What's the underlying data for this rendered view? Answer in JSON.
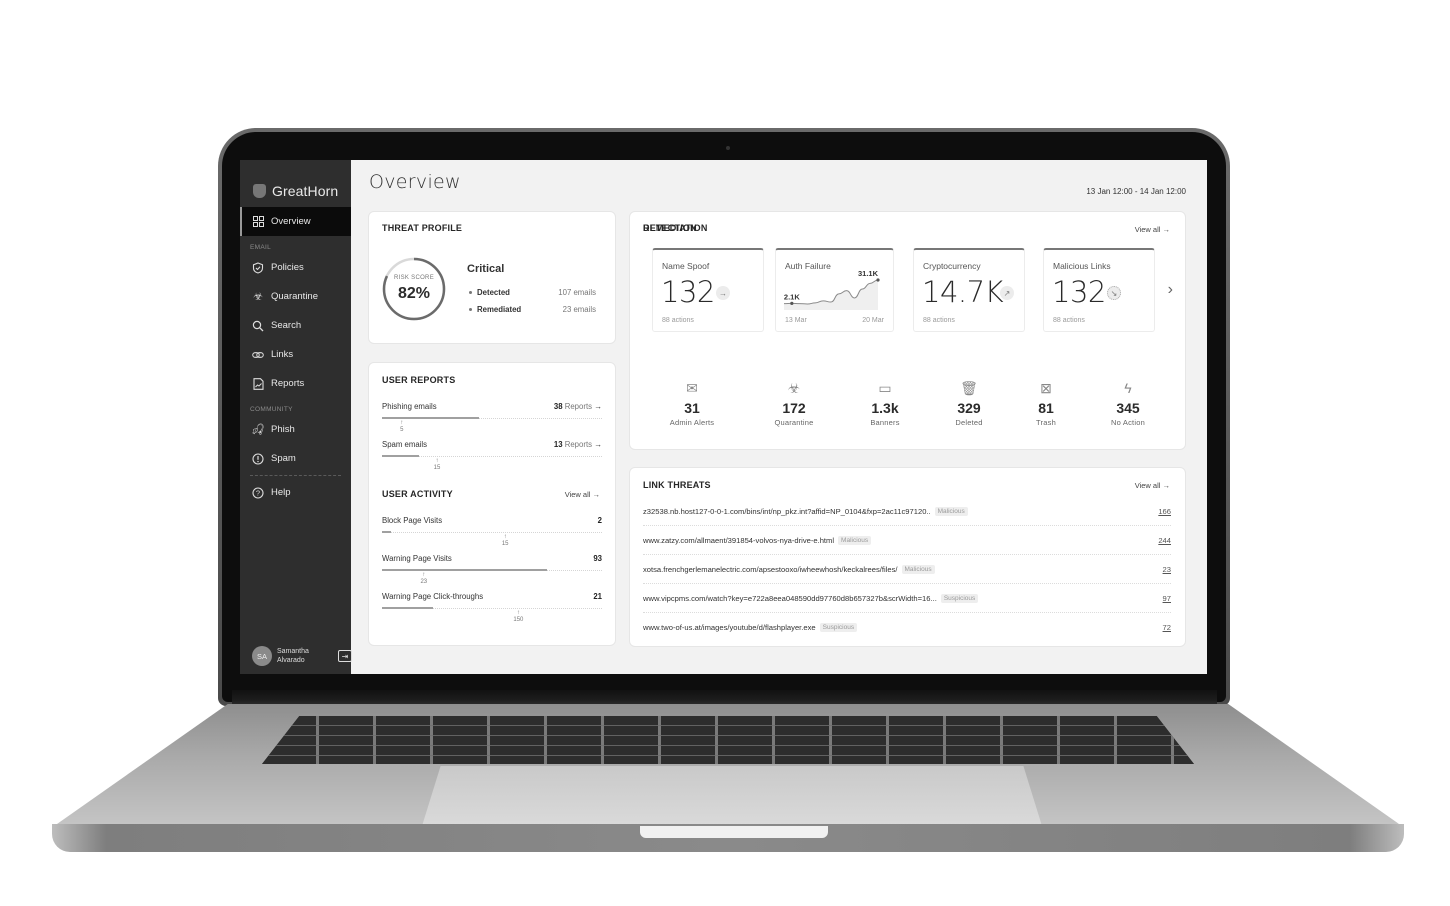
{
  "app": {
    "brand": "GreatHorn",
    "page_title": "Overview",
    "date_range": "13 Jan 12:00 - 14 Jan 12:00"
  },
  "sidebar": {
    "active": "Overview",
    "items": [
      {
        "label": "Overview",
        "icon": "grid-icon"
      },
      {
        "section": "EMAIL"
      },
      {
        "label": "Policies",
        "icon": "shield-check-icon"
      },
      {
        "label": "Quarantine",
        "icon": "biohazard-icon"
      },
      {
        "label": "Search",
        "icon": "search-icon"
      },
      {
        "label": "Links",
        "icon": "link-icon"
      },
      {
        "label": "Reports",
        "icon": "report-icon"
      },
      {
        "section": "COMMUNITY"
      },
      {
        "label": "Phish",
        "icon": "hook-icon"
      },
      {
        "label": "Spam",
        "icon": "alert-circle-icon"
      },
      {
        "label": "Help",
        "icon": "help-circle-icon"
      }
    ],
    "sections": {
      "email": "EMAIL",
      "community": "COMMUNITY"
    },
    "labels": {
      "overview": "Overview",
      "policies": "Policies",
      "quarantine": "Quarantine",
      "search": "Search",
      "links": "Links",
      "reports": "Reports",
      "phish": "Phish",
      "spam": "Spam",
      "help": "Help"
    },
    "user": {
      "initials": "SA",
      "name": "Samantha Alvarado"
    }
  },
  "threat_profile": {
    "title": "THREAT PROFILE",
    "risk_label": "RISK SCORE",
    "risk_score": "82%",
    "risk_fraction": 0.82,
    "status": "Critical",
    "rows": [
      {
        "label": "Detected",
        "value": "107 emails"
      },
      {
        "label": "Remediated",
        "value": "23 emails"
      }
    ]
  },
  "user_reports": {
    "title": "USER REPORTS",
    "items": [
      {
        "label": "Phishing emails",
        "count": "38",
        "unit": "Reports",
        "fill": 0.44,
        "marker": "5",
        "marker_pos": 0.09
      },
      {
        "label": "Spam emails",
        "count": "13",
        "unit": "Reports",
        "fill": 0.17,
        "marker": "15",
        "marker_pos": 0.25
      }
    ]
  },
  "user_activity": {
    "title": "USER ACTIVITY",
    "view_all": "View all",
    "items": [
      {
        "label": "Block Page Visits",
        "value": "2",
        "fill": 0.04,
        "marker": "15",
        "marker_pos": 0.56
      },
      {
        "label": "Warning Page Visits",
        "value": "93",
        "fill": 0.75,
        "marker": "23",
        "marker_pos": 0.19
      },
      {
        "label": "Warning Page Click-throughs",
        "value": "21",
        "fill": 0.23,
        "marker": "150",
        "marker_pos": 0.62
      }
    ]
  },
  "detection": {
    "title": "DETECTION",
    "view_all": "View all",
    "tiles": [
      {
        "title": "Name Spoof",
        "value": "132",
        "trend": "right",
        "sub": "88 actions"
      },
      {
        "title": "Auth Failure",
        "start_label": "2.1K",
        "end_label": "31.1K",
        "x_start": "13 Mar",
        "x_end": "20 Mar",
        "series": [
          2.1,
          2.4,
          2.1,
          1.6,
          3.0,
          5.5,
          4.0,
          14.0,
          18.0,
          9.0,
          20.0,
          27.0,
          31.1
        ]
      },
      {
        "title": "Cryptocurrency",
        "value": "14.7K",
        "trend": "up-right",
        "sub": "88 actions"
      },
      {
        "title": "Malicious Links",
        "value": "132",
        "trend": "down-right",
        "sub": "88 actions"
      }
    ]
  },
  "remediation": {
    "title": "REMEDIATION",
    "items": [
      {
        "value": "31",
        "label": "Admin Alerts",
        "icon": "mail-alert-icon"
      },
      {
        "value": "172",
        "label": "Quarantine",
        "icon": "biohazard-icon"
      },
      {
        "value": "1.3k",
        "label": "Banners",
        "icon": "banner-icon"
      },
      {
        "value": "329",
        "label": "Deleted",
        "icon": "trash-icon"
      },
      {
        "value": "81",
        "label": "Trash",
        "icon": "archive-x-icon"
      },
      {
        "value": "345",
        "label": "No Action",
        "icon": "bolt-icon"
      }
    ]
  },
  "link_threats": {
    "title": "LINK THREATS",
    "view_all": "View all",
    "rows": [
      {
        "url": "z32538.nb.host127-0-0-1.com/bins/int/np_pkz.int?affid=NP_0104&fxp=2ac11c97120..",
        "badge": "Malicious",
        "count": "166"
      },
      {
        "url": "www.zatzy.com/allmaent/391854-volvos-nya-drive-e.html",
        "badge": "Malicious",
        "count": "244"
      },
      {
        "url": "xotsa.frenchgerlemanelectric.com/apsestooxo/iwheewhosh/keckalrees/files/",
        "badge": "Malicious",
        "count": "23"
      },
      {
        "url": "www.vipcpms.com/watch?key=e722a8eea048590dd97760d8b657327b&scrWidth=16...",
        "badge": "Suspicious",
        "count": "97"
      },
      {
        "url": "www.two-of-us.at/images/youtube/d/flashplayer.exe",
        "badge": "Suspicious",
        "count": "72"
      }
    ]
  },
  "colors": {
    "sidebar_bg": "#2e2e2e",
    "sidebar_active_bg": "#0b0b0b",
    "content_bg": "#f2f2f2",
    "card_bg": "#ffffff",
    "accent": "#777777"
  }
}
